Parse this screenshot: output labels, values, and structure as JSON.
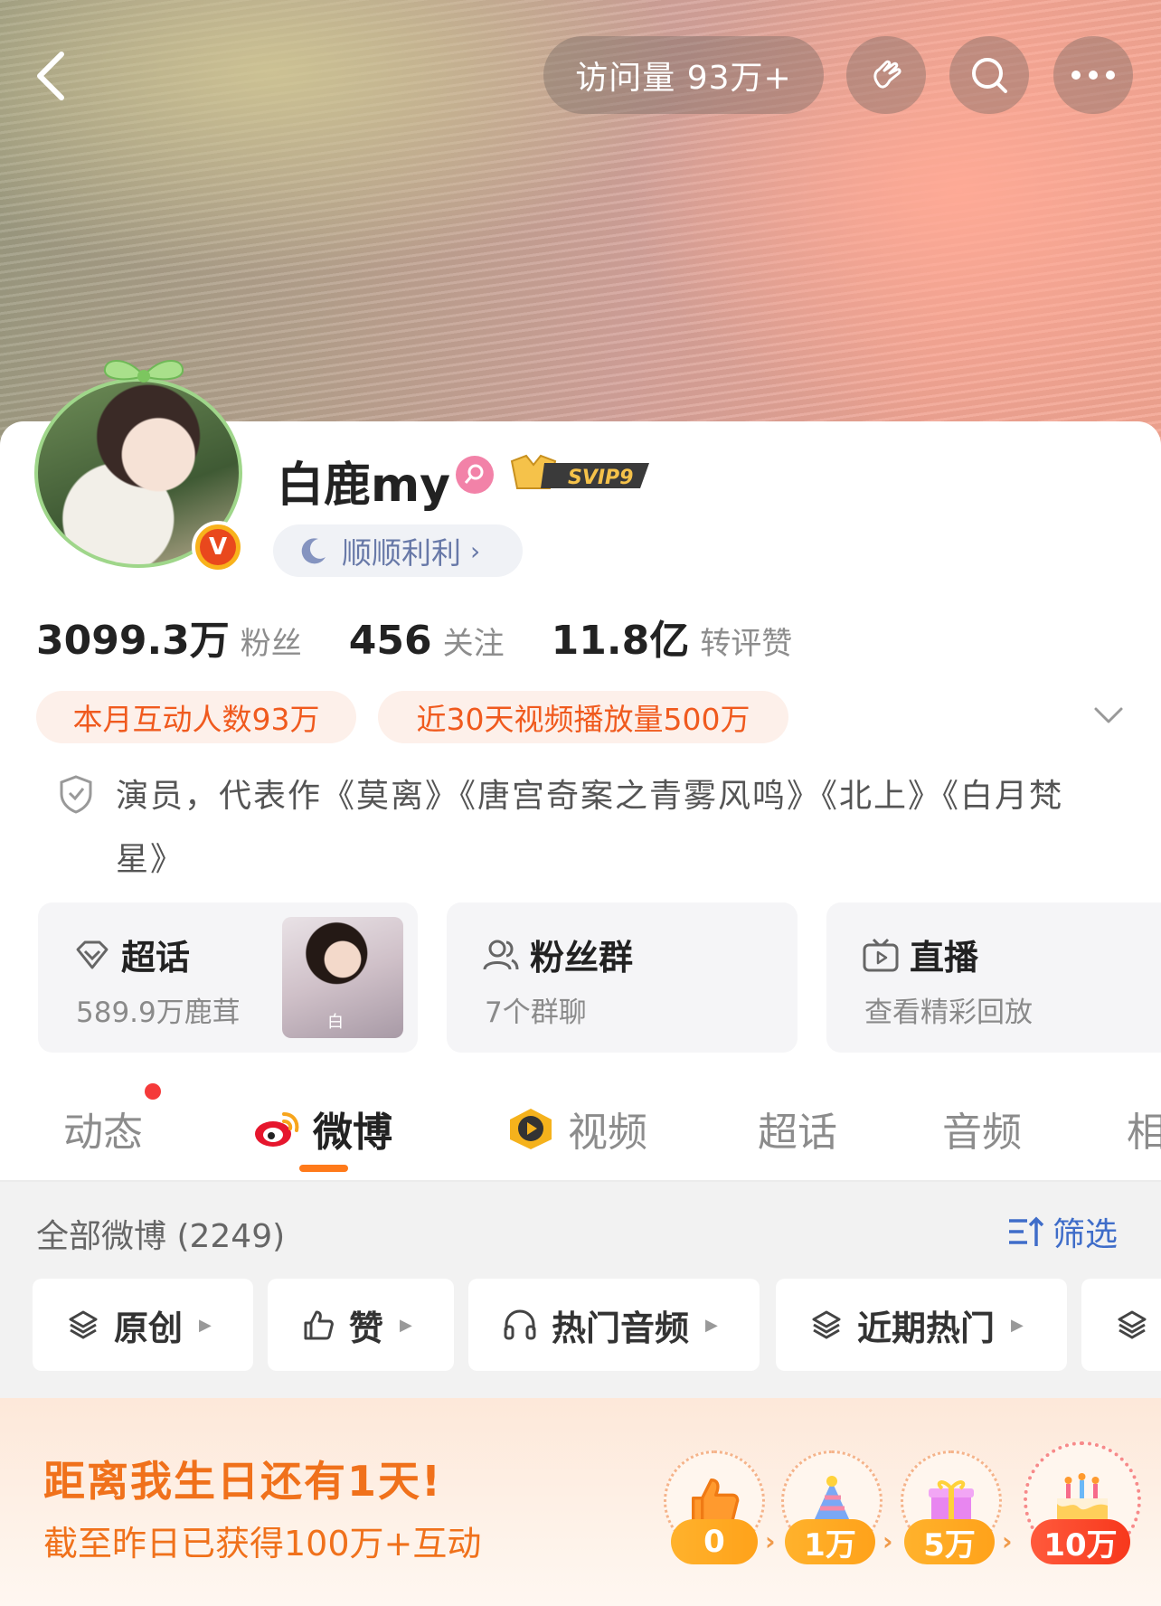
{
  "header": {
    "visits_label": "访问量 93万+",
    "icons": [
      "back-arrow-icon",
      "wave-hand-icon",
      "search-icon",
      "more-icon"
    ]
  },
  "profile": {
    "name": "白鹿my",
    "badge": "SVIP9",
    "nickname_tag": "顺顺利利",
    "verified_icon": "V"
  },
  "stats": [
    {
      "value": "3099.3万",
      "label": "粉丝"
    },
    {
      "value": "456",
      "label": "关注"
    },
    {
      "value": "11.8亿",
      "label": "转评赞"
    }
  ],
  "tags": [
    "本月互动人数93万",
    "近30天视频播放量500万"
  ],
  "bio": "演员，代表作《莫离》《唐宫奇案之青雾风鸣》《北上》《白月梵星》",
  "features": [
    {
      "title": "超话",
      "sub": "589.9万鹿茸",
      "thumb_text": "白"
    },
    {
      "title": "粉丝群",
      "sub": "7个群聊"
    },
    {
      "title": "直播",
      "sub": "查看精彩回放"
    }
  ],
  "tabs": [
    "动态",
    "微博",
    "视频",
    "超话",
    "音频",
    "相"
  ],
  "active_tab": "微博",
  "feed": {
    "all_label": "全部微博 (2249)",
    "filter_label": "筛选",
    "chips": [
      "原创",
      "赞",
      "热门音频",
      "近期热门"
    ]
  },
  "birthday": {
    "title": "距离我生日还有1天!",
    "subtitle": "截至昨日已获得100万+互动",
    "milestones": [
      "0",
      "1万",
      "5万",
      "10万"
    ]
  },
  "colors": {
    "accent": "#ff7a1a",
    "tag_text": "#f05a1e",
    "link_blue": "#3f6dc9"
  }
}
